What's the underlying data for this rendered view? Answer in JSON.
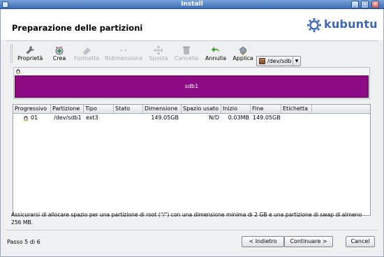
{
  "window": {
    "title": "Install"
  },
  "header": {
    "page_title": "Preparazione delle partizioni",
    "logo_text": "kubuntu",
    "brand_color": "#3c68b4"
  },
  "toolbar": {
    "items": [
      {
        "label": "Proprietà",
        "icon": "wrench-icon",
        "enabled": true
      },
      {
        "label": "Crea",
        "icon": "create-icon",
        "enabled": true
      },
      {
        "label": "Formatta",
        "icon": "eraser-icon",
        "enabled": false
      },
      {
        "label": "Ridimensiona",
        "icon": "resize-icon",
        "enabled": false
      },
      {
        "label": "Sposta",
        "icon": "move-icon",
        "enabled": false
      },
      {
        "label": "Cancella",
        "icon": "trash-icon",
        "enabled": false
      },
      {
        "label": "Annulla",
        "icon": "undo-icon",
        "enabled": true
      },
      {
        "label": "Applica",
        "icon": "apply-icon",
        "enabled": true
      }
    ],
    "device": "/dev/sdb"
  },
  "disk": {
    "partition_label": "sdb1",
    "partition_color": "#8d0a85"
  },
  "table": {
    "columns": [
      "Progressivo",
      "Partizione",
      "Tipo",
      "Stato",
      "Dimensione",
      "Spazio usato",
      "Inizio",
      "Fine",
      "Etichetta"
    ],
    "rows": [
      {
        "progressivo": "01",
        "partizione": "/dev/sdb1",
        "tipo": "ext3",
        "stato": "",
        "dimensione": "149.05GB",
        "spazio_usato": "N/D",
        "inizio": "0.03MB",
        "fine": "149.05GB",
        "etichetta": ""
      }
    ]
  },
  "info_text": "Assicurarsi di allocare spazio per una partizione di root (\"/\") con una dimensione minima di 2 GB e una partizione di swap di almeno 256 MB.",
  "footer": {
    "step": "Passo 5 di 6",
    "back": "< Indietro",
    "next": "Continuare >",
    "cancel": "Cancel"
  }
}
